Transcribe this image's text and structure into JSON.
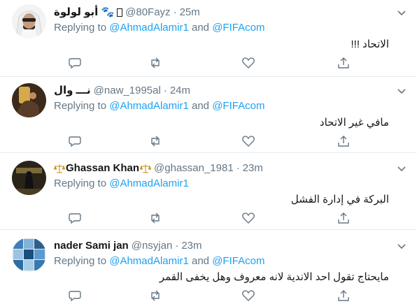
{
  "tweets": [
    {
      "name": "أبو لولوة 🐾",
      "name_suffix": "⁣",
      "handle": "@80Fayz",
      "dot": "·",
      "time": "25m",
      "replying_prefix": "Replying to",
      "mention1": "@AhmadAlamir1",
      "and": "and",
      "mention2": "@FIFAcom",
      "text": "الاتحاد !!!",
      "avatar_icon": "man-in-ghutra-avatar"
    },
    {
      "name": "نـــ وال",
      "handle": "@naw_1995al",
      "dot": "·",
      "time": "24m",
      "replying_prefix": "Replying to",
      "mention1": "@AhmadAlamir1",
      "and": "and",
      "mention2": "@FIFAcom",
      "text": "مافي غير الاتحاد",
      "avatar_icon": "golden-phone-avatar"
    },
    {
      "name": "Ghassan Khan",
      "handle": "@ghassan_1981",
      "dot": "·",
      "time": "23m",
      "replying_prefix": "Replying to",
      "mention1": "@AhmadAlamir1",
      "text": "البركة في إدارة الفشل",
      "avatar_icon": "dark-figure-avatar",
      "badge_icon": "balance-scale-icon"
    },
    {
      "name": "nader Sami jan",
      "handle": "@nsyjan",
      "dot": "·",
      "time": "23m",
      "replying_prefix": "Replying to",
      "mention1": "@AhmadAlamir1",
      "and": "and",
      "mention2": "@FIFAcom",
      "text": "مايحتاج تقول احد الاندية لانه معروف وهل يخفى القمر",
      "avatar_icon": "photo-collage-avatar"
    }
  ],
  "colors": {
    "link": "#1da1f2",
    "muted": "#657786",
    "text": "#14171a",
    "divider": "#e6ecf0"
  }
}
